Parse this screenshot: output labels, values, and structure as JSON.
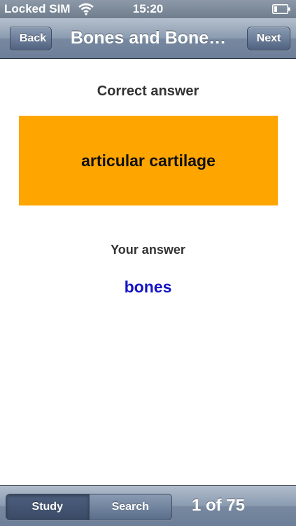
{
  "status_bar": {
    "carrier": "Locked SIM",
    "time": "15:20",
    "wifi_icon": "wifi-icon",
    "battery_icon": "battery-icon"
  },
  "nav": {
    "back_label": "Back",
    "title": "Bones and Bone…",
    "next_label": "Next"
  },
  "content": {
    "correct_heading": "Correct answer",
    "correct_answer": "articular cartilage",
    "your_heading": "Your answer",
    "your_answer": "bones"
  },
  "toolbar": {
    "segments": [
      {
        "label": "Study",
        "selected": true
      },
      {
        "label": "Search",
        "selected": false
      }
    ],
    "counter": "1 of  75"
  },
  "colors": {
    "answer_box": "#ffa500",
    "your_answer_text": "#1414c8",
    "bar_blue": "#6d7f98"
  }
}
